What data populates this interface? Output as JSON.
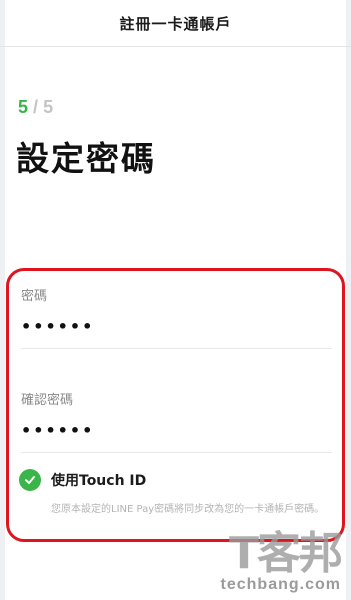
{
  "nav": {
    "title": "註冊一卡通帳戶"
  },
  "step": {
    "current": "5",
    "separator": "/",
    "total": "5"
  },
  "heading": "設定密碼",
  "form": {
    "password": {
      "label": "密碼",
      "value": "••••••"
    },
    "confirm": {
      "label": "確認密碼",
      "value": "••••••"
    }
  },
  "touch_id": {
    "label": "使用Touch ID",
    "checked": true,
    "note": "您原本設定的LINE Pay密碼將同步改為您的一卡通帳戶密碼。"
  },
  "watermark": {
    "logo": "T客邦",
    "text": "techbang.com"
  },
  "colors": {
    "accent": "#38b449",
    "highlight_border": "#e0141e"
  }
}
